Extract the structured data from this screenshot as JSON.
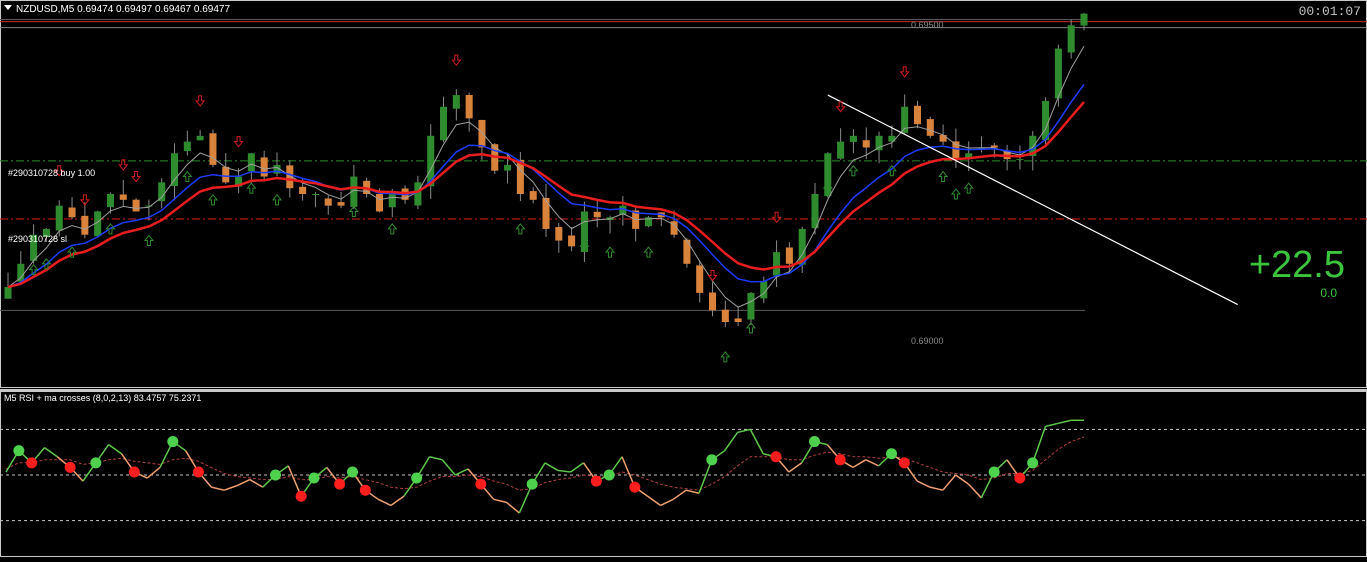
{
  "header": {
    "symbol_line": "NZDUSD,M5  0.69474 0.69497 0.69467 0.69477",
    "timer": "00:01:07"
  },
  "orders": {
    "buy_label": "#290310728 buy 1.00",
    "sl_label": "#290310728 sl"
  },
  "price_labels": {
    "top": "0.69500",
    "bottom": "0.69000"
  },
  "profit": {
    "main": "+22.5",
    "sub": "0.0"
  },
  "rsi": {
    "title": "M5 RSI + ma crosses (8,0,2,13) 83.4757 75.2371"
  },
  "colors": {
    "bull_candle": "#2e8b2e",
    "bear_candle": "#d9823b",
    "ma_fast": "#a0a0a0",
    "ma_mid": "#1e3cff",
    "ma_slow": "#e81e1e",
    "buy_line": "#2e8b2e",
    "sl_line": "#d21e1e",
    "rsi_up": "#5ec84a",
    "rsi_down": "#f0a070",
    "cross_up": "#4ed24e",
    "cross_down": "#ff1e1e"
  },
  "chart_data": [
    {
      "type": "candlestick",
      "symbol": "NZDUSD",
      "timeframe": "M5",
      "ylim": [
        0.6887,
        0.6953
      ],
      "gridlines": [
        0.69,
        0.695
      ],
      "close": [
        0.6904,
        0.6908,
        0.6913,
        0.6914,
        0.6918,
        0.6916,
        0.6913,
        0.6917,
        0.692,
        0.6919,
        0.6917,
        0.6918,
        0.6922,
        0.6927,
        0.6929,
        0.693,
        0.6925,
        0.6922,
        0.6923,
        0.6927,
        0.6923,
        0.6925,
        0.6921,
        0.692,
        0.692,
        0.6918,
        0.6918,
        0.6923,
        0.692,
        0.6917,
        0.692,
        0.6919,
        0.6922,
        0.693,
        0.6935,
        0.6937,
        0.6933,
        0.6928,
        0.6924,
        0.6925,
        0.692,
        0.6919,
        0.6914,
        0.6912,
        0.6911,
        0.6917,
        0.6916,
        0.6916,
        0.6918,
        0.6914,
        0.6916,
        0.6916,
        0.6913,
        0.6908,
        0.6903,
        0.69,
        0.6898,
        0.6898,
        0.6903,
        0.6905,
        0.691,
        0.6908,
        0.6914,
        0.692,
        0.6927,
        0.6929,
        0.693,
        0.6928,
        0.693,
        0.693,
        0.6935,
        0.6932,
        0.693,
        0.6929,
        0.6926,
        0.6927,
        0.6928,
        0.6928,
        0.6926,
        0.6926,
        0.693,
        0.6936,
        0.6945,
        0.6949,
        0.6951
      ],
      "series": [
        {
          "name": "",
          "style": "fast MA"
        },
        {
          "name": "",
          "style": "mid MA"
        },
        {
          "name": "",
          "style": "slow MA"
        }
      ],
      "trendline": {
        "from": [
          64,
          0.6937
        ],
        "to": [
          96,
          0.6901
        ]
      },
      "order_levels": {
        "buy": 0.69257,
        "stop_loss": 0.69157
      },
      "up_arrows_at": [
        2,
        3,
        5,
        8,
        11,
        14,
        16,
        19,
        21,
        27,
        30,
        40,
        45,
        47,
        50,
        56,
        58,
        64,
        66,
        69,
        73,
        74,
        75
      ],
      "down_arrows_at": [
        4,
        6,
        9,
        10,
        15,
        18,
        35,
        55,
        60,
        65,
        70
      ]
    },
    {
      "type": "line",
      "title": "M5 RSI + ma crosses (8,0,2,13) 83.4757 75.2371",
      "ylim": [
        0,
        100
      ],
      "levels": [
        80,
        50,
        20
      ],
      "rsi": [
        52,
        66,
        58,
        68,
        62,
        55,
        46,
        58,
        70,
        64,
        52,
        48,
        55,
        72,
        66,
        52,
        42,
        40,
        43,
        47,
        42,
        50,
        56,
        36,
        48,
        55,
        44,
        52,
        40,
        34,
        30,
        36,
        48,
        62,
        60,
        50,
        54,
        44,
        34,
        32,
        25,
        44,
        58,
        53,
        52,
        58,
        46,
        50,
        62,
        42,
        36,
        30,
        34,
        40,
        38,
        60,
        66,
        78,
        80,
        64,
        62,
        52,
        58,
        72,
        70,
        60,
        55,
        60,
        56,
        64,
        58,
        46,
        42,
        40,
        50,
        44,
        35,
        52,
        60,
        48,
        58,
        82,
        84,
        86,
        86
      ],
      "signal": [
        54,
        58,
        58,
        60,
        60,
        60,
        57,
        58,
        60,
        61,
        59,
        58,
        57,
        60,
        61,
        59,
        55,
        51,
        49,
        48,
        47,
        47,
        49,
        47,
        47,
        49,
        48,
        49,
        47,
        45,
        42,
        41,
        42,
        46,
        49,
        49,
        50,
        49,
        46,
        44,
        40,
        41,
        45,
        47,
        48,
        50,
        49,
        49,
        52,
        50,
        47,
        44,
        42,
        41,
        40,
        44,
        49,
        56,
        62,
        62,
        62,
        60,
        60,
        63,
        65,
        64,
        62,
        62,
        61,
        62,
        61,
        58,
        55,
        52,
        51,
        50,
        47,
        48,
        51,
        51,
        53,
        60,
        67,
        72,
        75
      ]
    }
  ]
}
